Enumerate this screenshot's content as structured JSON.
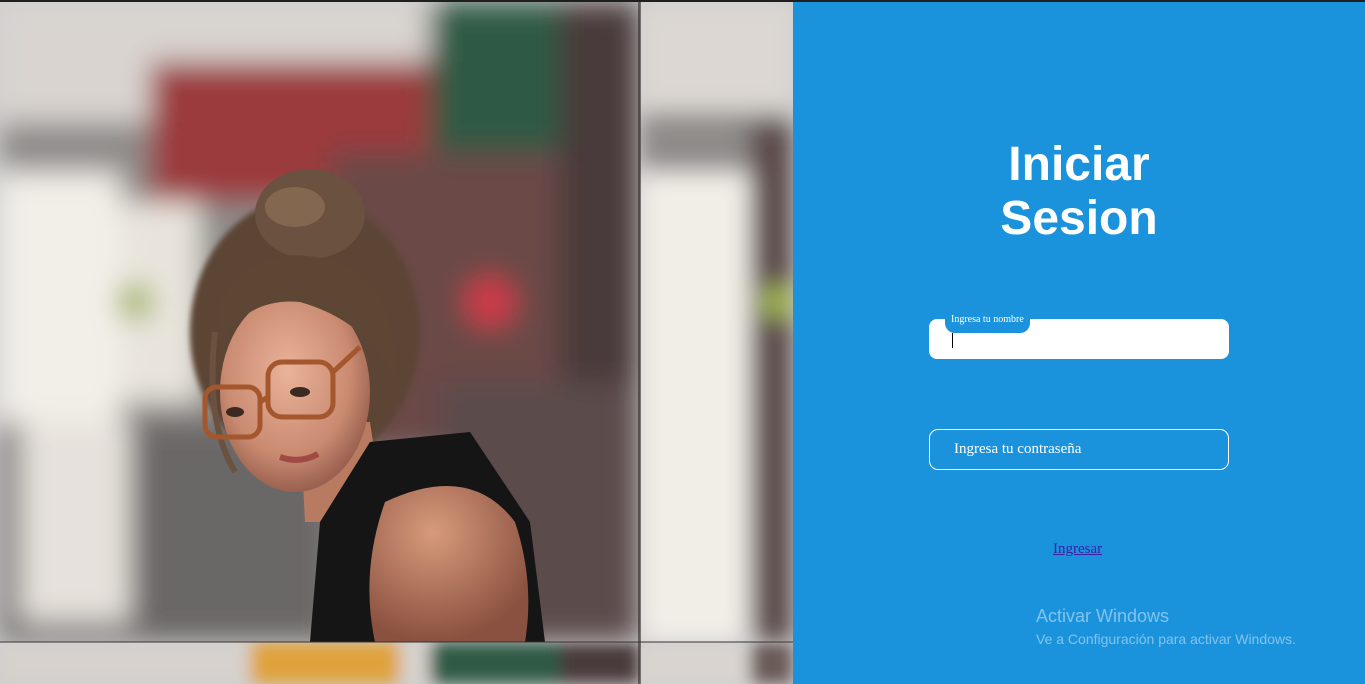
{
  "login": {
    "title_line1": "Iniciar",
    "title_line2": "Sesion",
    "name_label": "Ingresa tu nombre",
    "name_value": "",
    "password_placeholder": "Ingresa tu contraseña",
    "submit_label": "Ingresar"
  },
  "watermark": {
    "title": "Activar Windows",
    "subtitle": "Ve a Configuración para activar Windows."
  },
  "colors": {
    "panel": "#1b93dc",
    "link": "#3a1fa0"
  }
}
